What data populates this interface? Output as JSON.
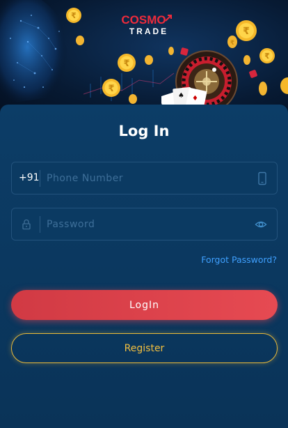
{
  "brand": {
    "name_top": "COSMO",
    "name_bottom": "TRADE"
  },
  "page": {
    "title": "Log In"
  },
  "phone": {
    "prefix": "+91",
    "placeholder": "Phone Number",
    "value": ""
  },
  "password": {
    "placeholder": "Password",
    "value": ""
  },
  "links": {
    "forgot_password": "Forgot Password?"
  },
  "buttons": {
    "login": "LogIn",
    "register": "Register"
  },
  "icons": {
    "phone": "mobile-phone-icon",
    "lock": "lock-icon",
    "eye": "eye-icon",
    "logo_arrow": "arrow-up-right-icon"
  },
  "colors": {
    "background": "#0a2d4d",
    "panel": "#0b3a63",
    "accent_red": "#e64a52",
    "accent_gold": "#e8b93a",
    "link_blue": "#3fa0ff",
    "placeholder": "#3e6f99"
  }
}
